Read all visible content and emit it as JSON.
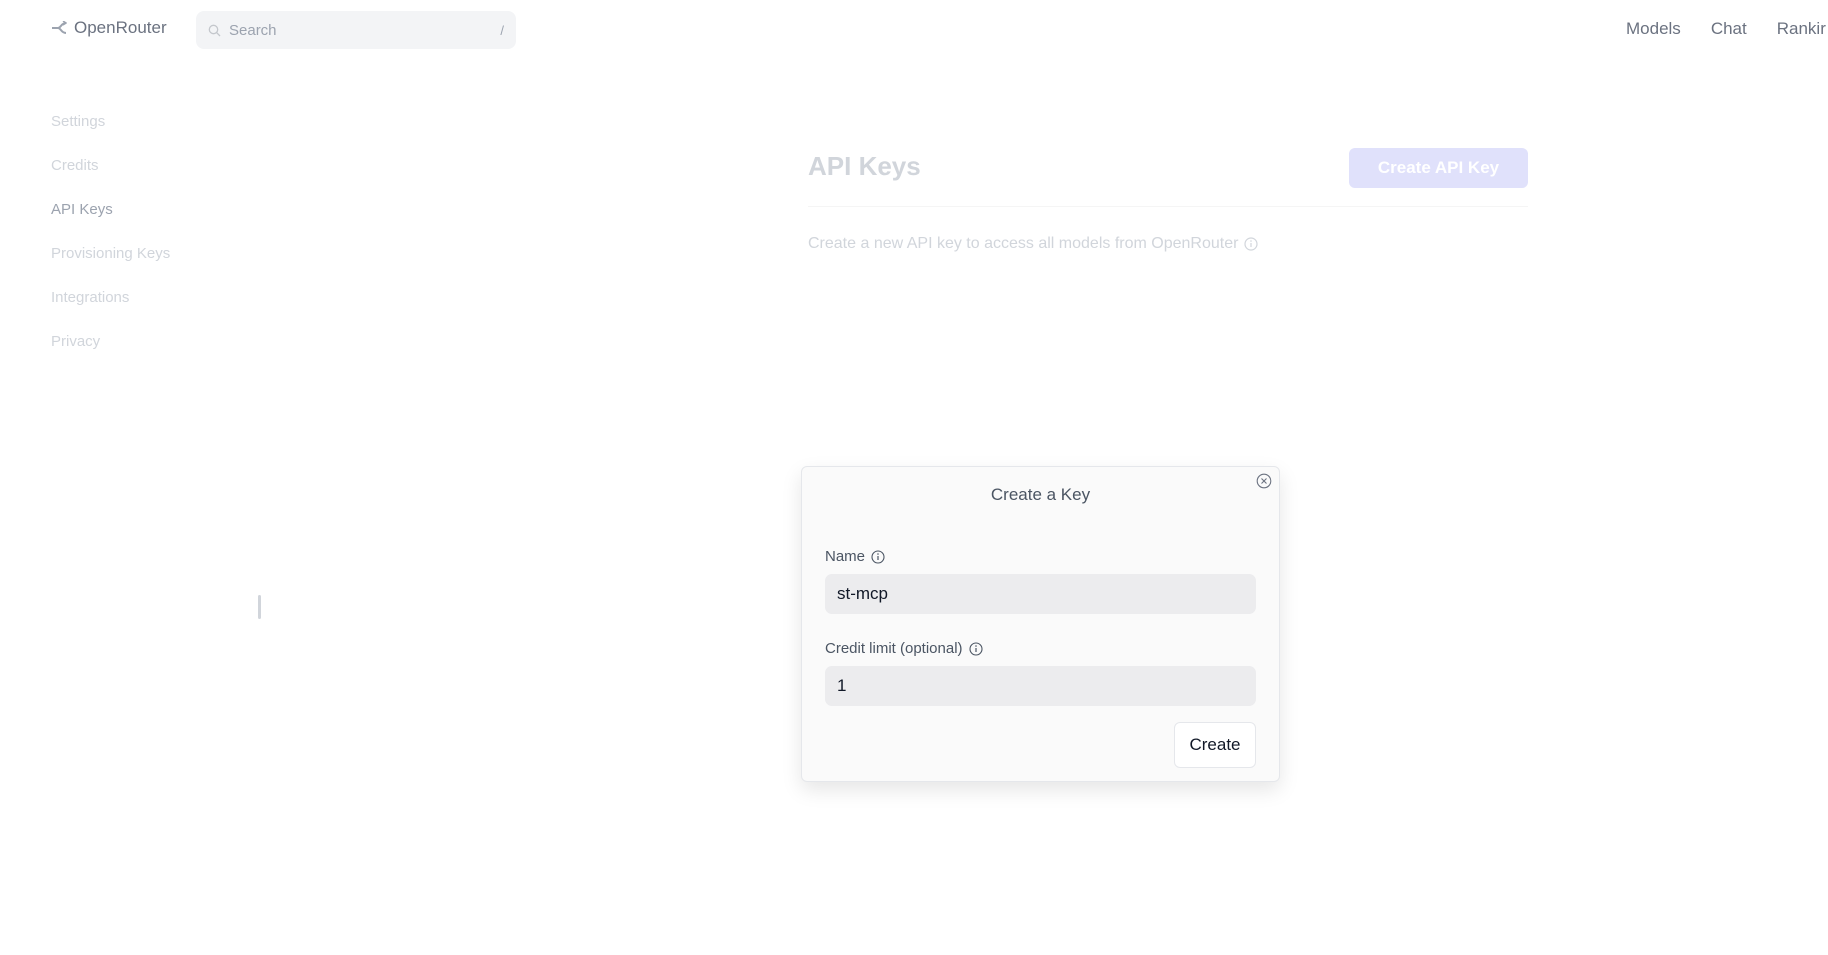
{
  "header": {
    "brand": "OpenRouter",
    "search_placeholder": "Search",
    "search_shortcut": "/",
    "nav": [
      "Models",
      "Chat",
      "Rankir"
    ]
  },
  "sidebar": {
    "items": [
      {
        "label": "Settings",
        "active": false
      },
      {
        "label": "Credits",
        "active": false
      },
      {
        "label": "API Keys",
        "active": true
      },
      {
        "label": "Provisioning Keys",
        "active": false
      },
      {
        "label": "Integrations",
        "active": false
      },
      {
        "label": "Privacy",
        "active": false
      }
    ]
  },
  "main": {
    "title": "API Keys",
    "create_button": "Create API Key",
    "description": "Create a new API key to access all models from OpenRouter"
  },
  "modal": {
    "title": "Create a Key",
    "name_label": "Name",
    "name_value": "st-mcp",
    "credit_label": "Credit limit (optional)",
    "credit_value": "1",
    "submit_label": "Create"
  },
  "colors": {
    "accent_disabled": "#e0e1fb",
    "muted_text": "#d1d5db",
    "input_bg": "#ececee"
  }
}
